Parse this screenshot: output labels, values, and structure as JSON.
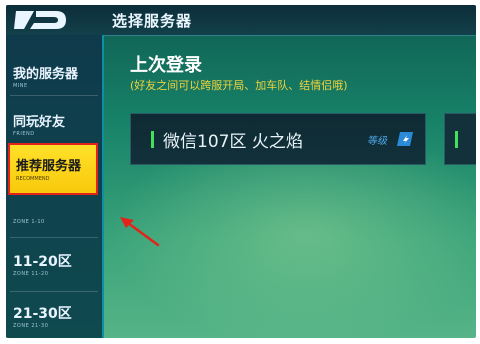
{
  "header": {
    "title": "选择服务器"
  },
  "sidebar": {
    "items": [
      {
        "label": "我的服务器",
        "sublabel": "MINE"
      },
      {
        "label": "同玩好友",
        "sublabel": "FRIEND"
      },
      {
        "label": "推荐服务器",
        "sublabel": "RECOMMEND",
        "selected": true
      },
      {
        "label": "",
        "sublabel": "ZONE 1-10"
      },
      {
        "label": "11-20区",
        "sublabel": "ZONE 11-20"
      },
      {
        "label": "21-30区",
        "sublabel": "ZONE 21-30"
      }
    ]
  },
  "main": {
    "title": "上次登录",
    "subtitle": "(好友之间可以跨服开局、加车队、结情侣哦)",
    "server_card": {
      "name": "微信107区 火之焰",
      "level_label": "等级"
    }
  },
  "colors": {
    "selected_bg": "#f8c90b",
    "selected_border": "#e32319",
    "subtitle": "#f0d33d",
    "status_green": "#42e15a",
    "arrow": "#e32319"
  }
}
